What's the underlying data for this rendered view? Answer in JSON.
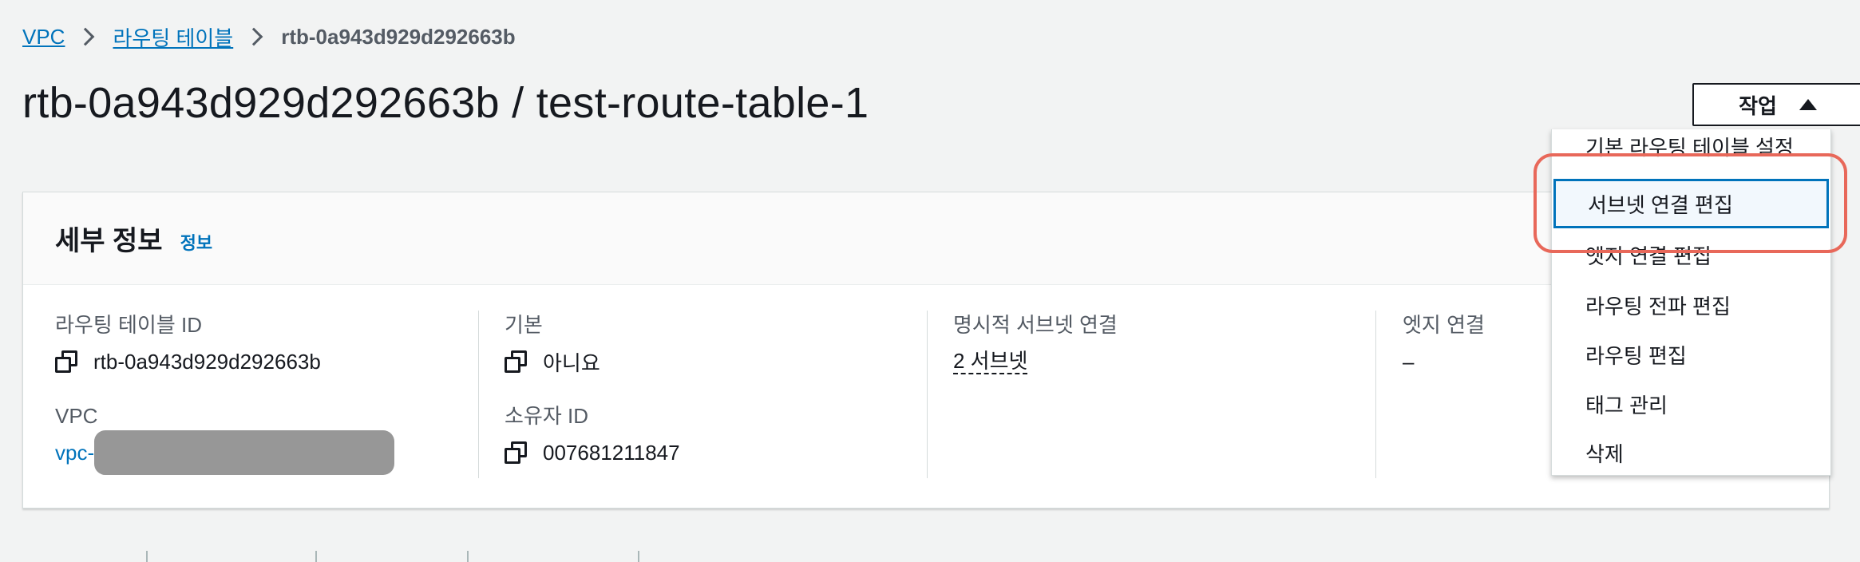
{
  "breadcrumb": {
    "vpc": "VPC",
    "route_tables": "라우팅 테이블",
    "current": "rtb-0a943d929d292663b"
  },
  "page_title": "rtb-0a943d929d292663b / test-route-table-1",
  "actions_button": {
    "label": "작업"
  },
  "details": {
    "title": "세부 정보",
    "info_link": "정보",
    "route_table_id": {
      "label": "라우팅 테이블 ID",
      "value": "rtb-0a943d929d292663b"
    },
    "vpc": {
      "label": "VPC",
      "value": "vpc-"
    },
    "main": {
      "label": "기본",
      "value": "아니요"
    },
    "owner_id": {
      "label": "소유자 ID",
      "value": "007681211847"
    },
    "explicit_subnets": {
      "label": "명시적 서브넷 연결",
      "value": "2 서브넷"
    },
    "edge_assoc": {
      "label": "엣지 연결",
      "value": "–"
    }
  },
  "actions_menu": {
    "items": [
      {
        "label": "기본 라우팅 테이블 설정"
      },
      {
        "label": "서브넷 연결 편집",
        "active": true
      },
      {
        "label": "엣지 연결 편집"
      },
      {
        "label": "라우팅 전파 편집"
      },
      {
        "label": "라우팅 편집"
      },
      {
        "label": "태그 관리"
      },
      {
        "label": "삭제"
      }
    ]
  },
  "colors": {
    "link": "#0073bb",
    "highlight_ring": "#e8685a",
    "text": "#16191f",
    "muted": "#545b64"
  }
}
